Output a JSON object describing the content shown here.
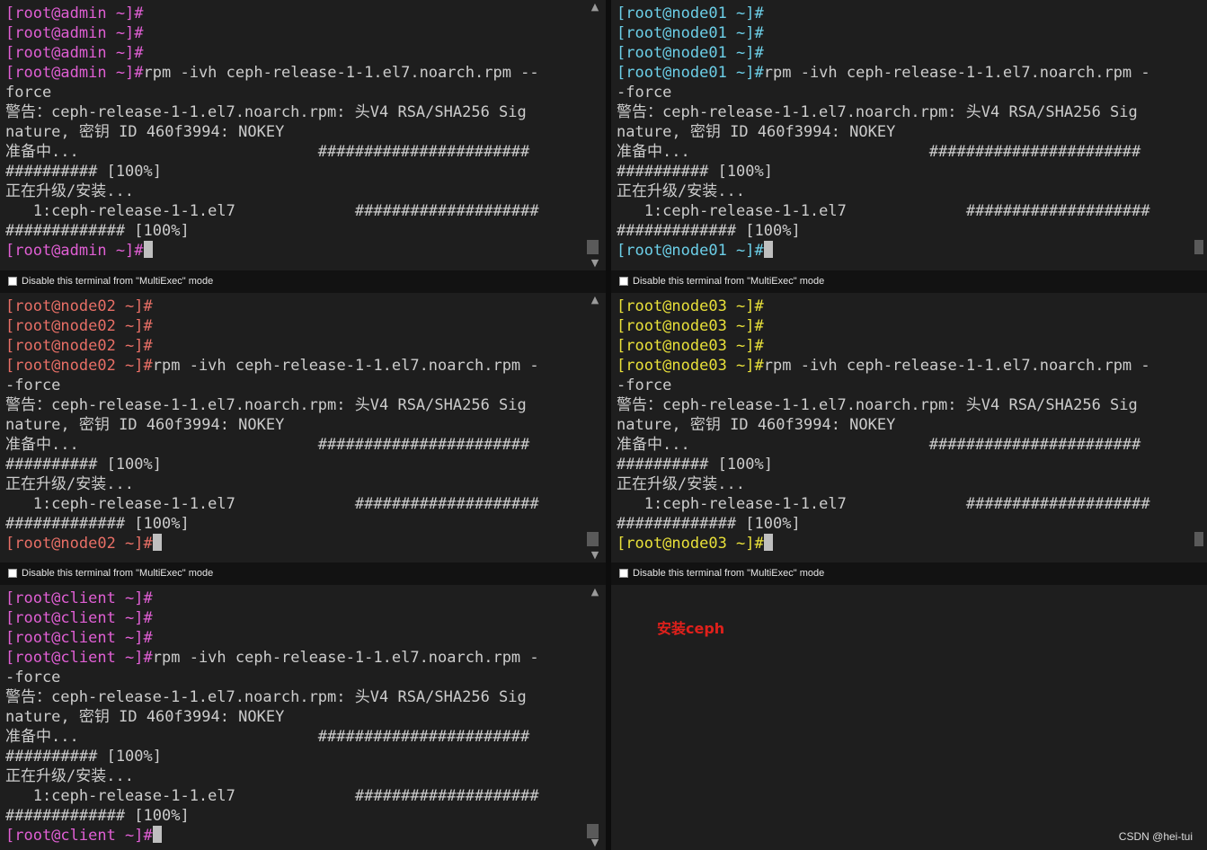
{
  "colors": {
    "admin": "#e05fd4",
    "node01": "#6ccfe8",
    "node02": "#e86f66",
    "node03": "#e8e03a",
    "client": "#e05fd4",
    "text": "#cccccc",
    "annotation": "#e0201b"
  },
  "multiexec_label": "Disable this terminal from \"MultiExec\" mode",
  "annotation": "安装ceph",
  "watermark": "CSDN @hei-tui",
  "terminals": [
    {
      "host": "admin",
      "lines": [
        {
          "prompt": "[root@admin ~]#",
          "text": ""
        },
        {
          "prompt": "[root@admin ~]#",
          "text": ""
        },
        {
          "prompt": "[root@admin ~]#",
          "text": ""
        },
        {
          "prompt": "[root@admin ~]#",
          "text": "rpm -ivh ceph-release-1-1.el7.noarch.rpm --"
        },
        {
          "prompt": "",
          "text": "force"
        },
        {
          "prompt": "",
          "text": "警告：ceph-release-1-1.el7.noarch.rpm: 头V4 RSA/SHA256 Sig"
        },
        {
          "prompt": "",
          "text": "nature, 密钥 ID 460f3994: NOKEY"
        },
        {
          "prompt": "",
          "text": "准备中...                          #######################"
        },
        {
          "prompt": "",
          "text": "########## [100%]"
        },
        {
          "prompt": "",
          "text": "正在升级/安装..."
        },
        {
          "prompt": "",
          "text": "   1:ceph-release-1-1.el7             ####################"
        },
        {
          "prompt": "",
          "text": "############# [100%]"
        },
        {
          "prompt": "[root@admin ~]#",
          "text": "",
          "cursor": true
        }
      ]
    },
    {
      "host": "node01",
      "lines": [
        {
          "prompt": "[root@node01 ~]#",
          "text": ""
        },
        {
          "prompt": "[root@node01 ~]#",
          "text": ""
        },
        {
          "prompt": "[root@node01 ~]#",
          "text": ""
        },
        {
          "prompt": "[root@node01 ~]#",
          "text": "rpm -ivh ceph-release-1-1.el7.noarch.rpm -"
        },
        {
          "prompt": "",
          "text": "-force"
        },
        {
          "prompt": "",
          "text": "警告：ceph-release-1-1.el7.noarch.rpm: 头V4 RSA/SHA256 Sig"
        },
        {
          "prompt": "",
          "text": "nature, 密钥 ID 460f3994: NOKEY"
        },
        {
          "prompt": "",
          "text": "准备中...                          #######################"
        },
        {
          "prompt": "",
          "text": "########## [100%]"
        },
        {
          "prompt": "",
          "text": "正在升级/安装..."
        },
        {
          "prompt": "",
          "text": "   1:ceph-release-1-1.el7             ####################"
        },
        {
          "prompt": "",
          "text": "############# [100%]"
        },
        {
          "prompt": "[root@node01 ~]#",
          "text": "",
          "cursor": true
        }
      ]
    },
    {
      "host": "node02",
      "lines": [
        {
          "prompt": "[root@node02 ~]#",
          "text": ""
        },
        {
          "prompt": "[root@node02 ~]#",
          "text": ""
        },
        {
          "prompt": "[root@node02 ~]#",
          "text": ""
        },
        {
          "prompt": "[root@node02 ~]#",
          "text": "rpm -ivh ceph-release-1-1.el7.noarch.rpm -"
        },
        {
          "prompt": "",
          "text": "-force"
        },
        {
          "prompt": "",
          "text": "警告：ceph-release-1-1.el7.noarch.rpm: 头V4 RSA/SHA256 Sig"
        },
        {
          "prompt": "",
          "text": "nature, 密钥 ID 460f3994: NOKEY"
        },
        {
          "prompt": "",
          "text": "准备中...                          #######################"
        },
        {
          "prompt": "",
          "text": "########## [100%]"
        },
        {
          "prompt": "",
          "text": "正在升级/安装..."
        },
        {
          "prompt": "",
          "text": "   1:ceph-release-1-1.el7             ####################"
        },
        {
          "prompt": "",
          "text": "############# [100%]"
        },
        {
          "prompt": "[root@node02 ~]#",
          "text": "",
          "cursor": true
        }
      ]
    },
    {
      "host": "node03",
      "lines": [
        {
          "prompt": "[root@node03 ~]#",
          "text": ""
        },
        {
          "prompt": "[root@node03 ~]#",
          "text": ""
        },
        {
          "prompt": "[root@node03 ~]#",
          "text": ""
        },
        {
          "prompt": "[root@node03 ~]#",
          "text": "rpm -ivh ceph-release-1-1.el7.noarch.rpm -"
        },
        {
          "prompt": "",
          "text": "-force"
        },
        {
          "prompt": "",
          "text": "警告：ceph-release-1-1.el7.noarch.rpm: 头V4 RSA/SHA256 Sig"
        },
        {
          "prompt": "",
          "text": "nature, 密钥 ID 460f3994: NOKEY"
        },
        {
          "prompt": "",
          "text": "准备中...                          #######################"
        },
        {
          "prompt": "",
          "text": "########## [100%]"
        },
        {
          "prompt": "",
          "text": "正在升级/安装..."
        },
        {
          "prompt": "",
          "text": "   1:ceph-release-1-1.el7             ####################"
        },
        {
          "prompt": "",
          "text": "############# [100%]"
        },
        {
          "prompt": "[root@node03 ~]#",
          "text": "",
          "cursor": true
        }
      ]
    },
    {
      "host": "client",
      "lines": [
        {
          "prompt": "[root@client ~]#",
          "text": ""
        },
        {
          "prompt": "[root@client ~]#",
          "text": ""
        },
        {
          "prompt": "[root@client ~]#",
          "text": ""
        },
        {
          "prompt": "[root@client ~]#",
          "text": "rpm -ivh ceph-release-1-1.el7.noarch.rpm -"
        },
        {
          "prompt": "",
          "text": "-force"
        },
        {
          "prompt": "",
          "text": "警告：ceph-release-1-1.el7.noarch.rpm: 头V4 RSA/SHA256 Sig"
        },
        {
          "prompt": "",
          "text": "nature, 密钥 ID 460f3994: NOKEY"
        },
        {
          "prompt": "",
          "text": "准备中...                          #######################"
        },
        {
          "prompt": "",
          "text": "########## [100%]"
        },
        {
          "prompt": "",
          "text": "正在升级/安装..."
        },
        {
          "prompt": "",
          "text": "   1:ceph-release-1-1.el7             ####################"
        },
        {
          "prompt": "",
          "text": "############# [100%]"
        },
        {
          "prompt": "[root@client ~]#",
          "text": "",
          "cursor": true
        }
      ]
    }
  ]
}
